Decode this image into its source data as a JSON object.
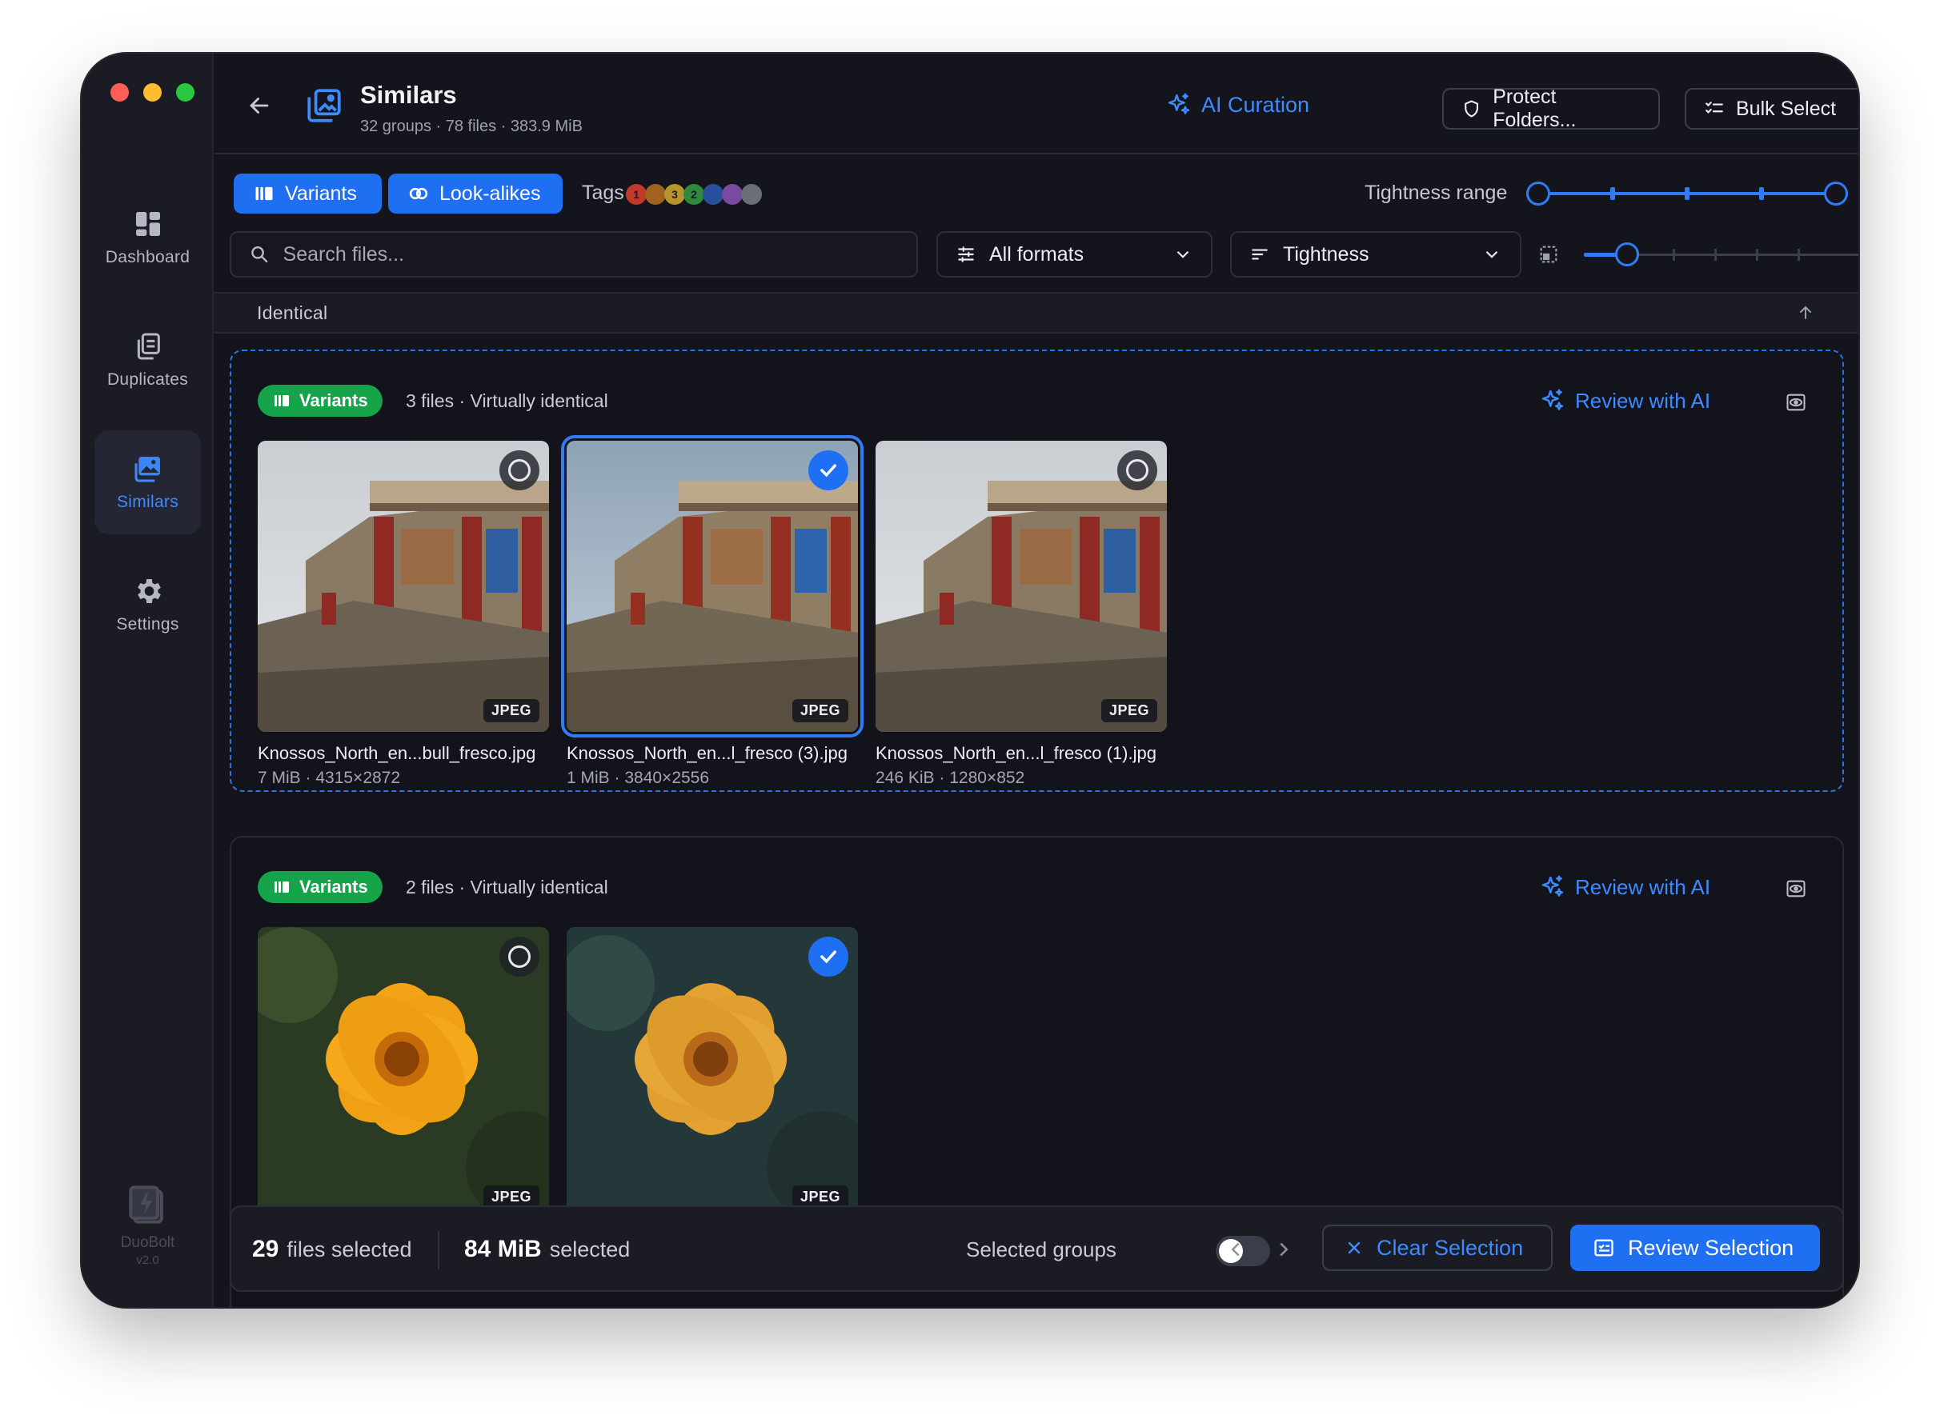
{
  "sidebar": {
    "items": [
      {
        "label": "Dashboard"
      },
      {
        "label": "Duplicates"
      },
      {
        "label": "Similars"
      },
      {
        "label": "Settings"
      }
    ],
    "brand": {
      "name": "DuoBolt",
      "version": "v2.0"
    }
  },
  "header": {
    "title": "Similars",
    "subtitle": "32 groups · 78 files · 383.9 MiB",
    "ai_curation": "AI Curation",
    "protect_folders": "Protect Folders...",
    "bulk_select": "Bulk Select"
  },
  "toolbar": {
    "variants": "Variants",
    "lookalikes": "Look-alikes",
    "tags_label": "Tags",
    "tags": [
      {
        "label": "1",
        "color": "#c0392b"
      },
      {
        "label": "",
        "color": "#a0631f"
      },
      {
        "label": "3",
        "color": "#b7952a"
      },
      {
        "label": "2",
        "color": "#2e8b3e"
      },
      {
        "label": "",
        "color": "#2a4f9a"
      },
      {
        "label": "",
        "color": "#7a4aa0"
      },
      {
        "label": "",
        "color": "#6b6e78"
      }
    ],
    "tightness_range_label": "Tightness range",
    "search_placeholder": "Search files...",
    "formats_dropdown": "All formats",
    "sort_dropdown": "Tightness"
  },
  "section": {
    "title": "Identical"
  },
  "groups": [
    {
      "badge": "Variants",
      "info": "3 files · Virtually identical",
      "review_ai": "Review with AI",
      "files": [
        {
          "name": "Knossos_North_en...bull_fresco.jpg",
          "meta": "7 MiB · 4315×2872",
          "format": "JPEG",
          "selected": false
        },
        {
          "name": "Knossos_North_en...l_fresco (3).jpg",
          "meta": "1 MiB · 3840×2556",
          "format": "JPEG",
          "selected": true
        },
        {
          "name": "Knossos_North_en...l_fresco (1).jpg",
          "meta": "246 KiB · 1280×852",
          "format": "JPEG",
          "selected": false
        }
      ]
    },
    {
      "badge": "Variants",
      "info": "2 files · Virtually identical",
      "review_ai": "Review with AI",
      "files": [
        {
          "format": "JPEG",
          "selected": false
        },
        {
          "format": "JPEG",
          "selected": true
        }
      ]
    }
  ],
  "bottom_bar": {
    "files_count": "29",
    "files_label": "files selected",
    "size_value": "84 MiB",
    "size_label": "selected",
    "selected_groups_label": "Selected groups",
    "selected_groups_on": false,
    "clear_selection": "Clear Selection",
    "review_selection": "Review Selection"
  },
  "colors": {
    "accent": "#1f6ff2",
    "badge_green": "#16a34a",
    "background": "#13141c",
    "sidebar": "#1a1b23"
  }
}
